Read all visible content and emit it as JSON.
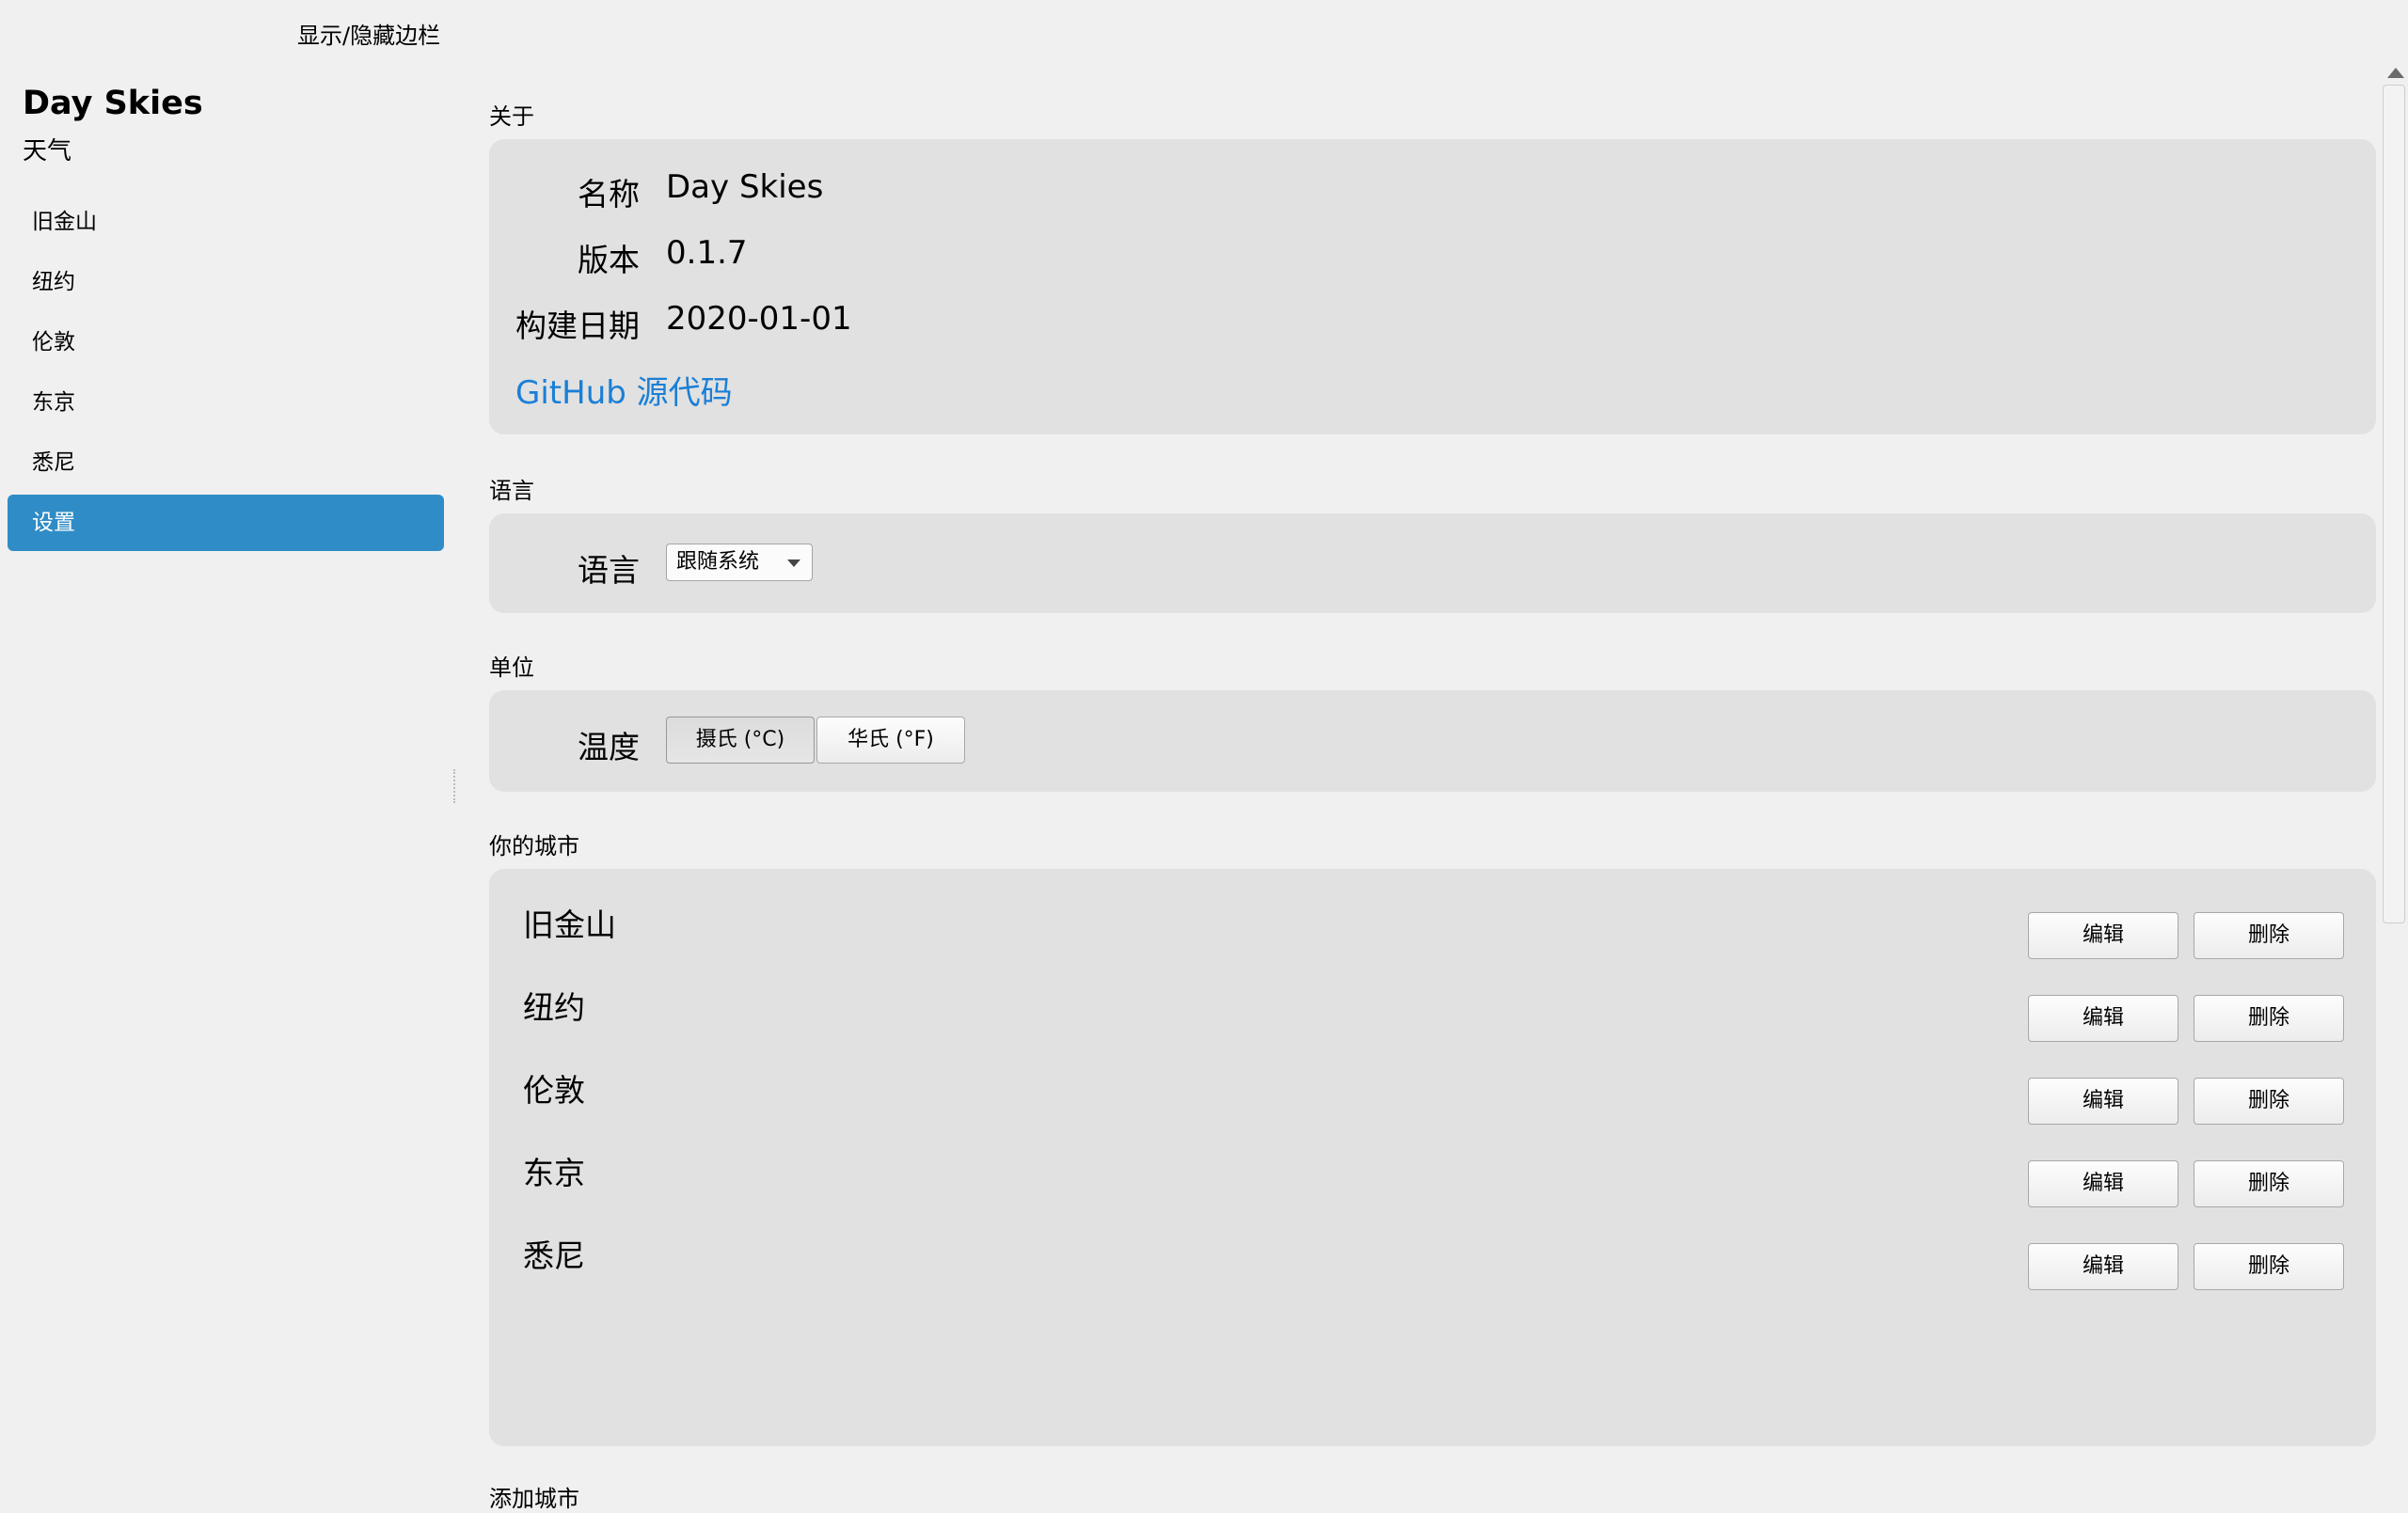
{
  "header": {
    "toggle_sidebar": "显示/隐藏边栏"
  },
  "sidebar": {
    "title": "Day Skies",
    "subtitle": "天气",
    "items": [
      {
        "label": "旧金山"
      },
      {
        "label": "纽约"
      },
      {
        "label": "伦敦"
      },
      {
        "label": "东京"
      },
      {
        "label": "悉尼"
      },
      {
        "label": "设置",
        "active": true
      }
    ]
  },
  "about": {
    "section_title": "关于",
    "name_label": "名称",
    "name_value": "Day Skies",
    "version_label": "版本",
    "version_value": "0.1.7",
    "build_label": "构建日期",
    "build_value": "2020-01-01",
    "github_link": "GitHub 源代码"
  },
  "language": {
    "section_title": "语言",
    "label": "语言",
    "selected": "跟随系统"
  },
  "units": {
    "section_title": "单位",
    "temperature_label": "温度",
    "celsius": "摄氏 (°C)",
    "fahrenheit": "华氏 (°F)",
    "selected": "celsius"
  },
  "cities": {
    "section_title": "你的城市",
    "edit_label": "编辑",
    "delete_label": "删除",
    "list": [
      {
        "name": "旧金山"
      },
      {
        "name": "纽约"
      },
      {
        "name": "伦敦"
      },
      {
        "name": "东京"
      },
      {
        "name": "悉尼"
      }
    ]
  },
  "add_city": {
    "section_title": "添加城市"
  },
  "colors": {
    "accent": "#308cc6",
    "link": "#1a7fd6",
    "card": "#e1e1e1",
    "background": "#f0f0f0"
  }
}
